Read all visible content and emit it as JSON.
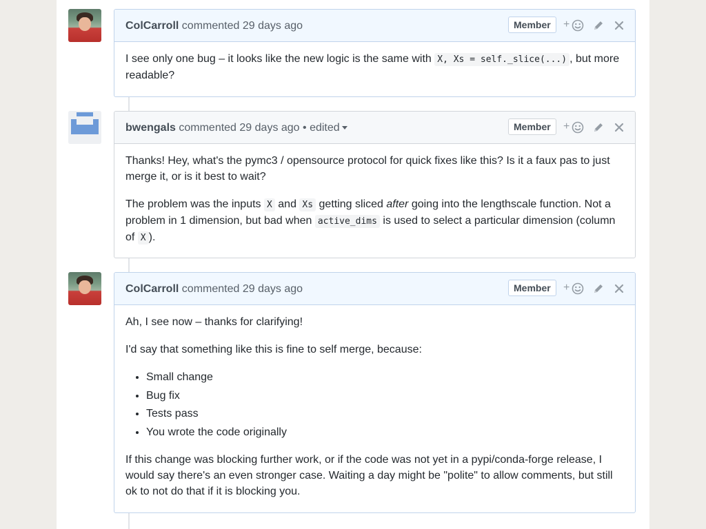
{
  "comments": [
    {
      "author": "ColCarroll",
      "meta": "commented 29 days ago",
      "badge": "Member",
      "body": {
        "p1_a": "I see only one bug – it looks like the new logic is the same with ",
        "p1_code": "X, Xs = self._slice(...)",
        "p1_b": ", but more readable?"
      }
    },
    {
      "author": "bwengals",
      "meta": "commented 29 days ago",
      "edited": "• edited",
      "badge": "Member",
      "body": {
        "p1": "Thanks! Hey, what's the pymc3 / opensource protocol for quick fixes like this? Is it a faux pas to just merge it, or is it best to wait?",
        "p2_a": "The problem was the inputs ",
        "p2_code1": "X",
        "p2_b": " and ",
        "p2_code2": "Xs",
        "p2_c": " getting sliced ",
        "p2_em": "after",
        "p2_d": " going into the lengthscale function. Not a problem in 1 dimension, but bad when ",
        "p2_code3": "active_dims",
        "p2_e": " is used to select a particular dimension (column of ",
        "p2_code4": "X",
        "p2_f": ")."
      }
    },
    {
      "author": "ColCarroll",
      "meta": "commented 29 days ago",
      "badge": "Member",
      "body": {
        "p1": "Ah, I see now – thanks for clarifying!",
        "p2": "I'd say that something like this is fine to self merge, because:",
        "list": [
          "Small change",
          "Bug fix",
          "Tests pass",
          "You wrote the code originally"
        ],
        "p3": "If this change was blocking further work, or if the code was not yet in a pypi/conda-forge release, I would say there's an even stronger case. Waiting a day might be \"polite\" to allow comments, but still ok to not do that if it is blocking you."
      }
    }
  ],
  "actions": {
    "reaction_plus": "+",
    "icons": [
      "smiley-icon",
      "pencil-icon",
      "close-icon"
    ]
  },
  "colors": {
    "member_header": "#f1f8ff",
    "border": "#d1d5da",
    "text": "#24292e"
  }
}
